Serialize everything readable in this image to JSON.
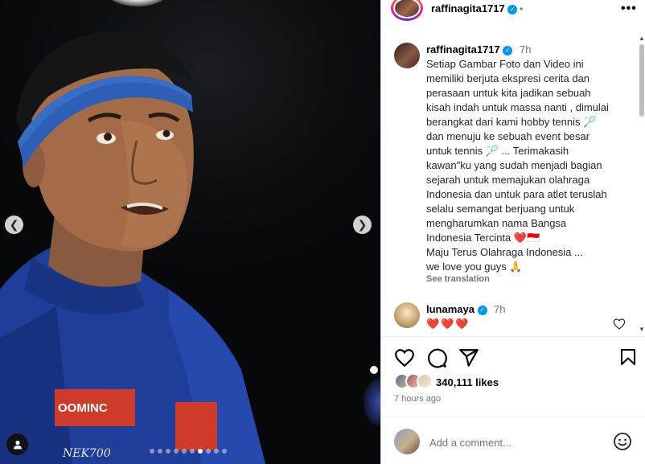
{
  "post": {
    "username": "raffinagita1717",
    "time": "7h",
    "caption": "Setiap Gambar Foto dan Video ini\nmemiliki berjuta ekspresi cerita dan\nperasaan untuk kita jadikan sebuah\nkisah indah untuk massa nanti , dimulai\nberangkat dari kami hobby tennis 🏸\ndan menuju ke sebuah event besar\nuntuk tennis 🏸 ... Terimakasih\nkawan\"ku yang sudah menjadi bagian\nsejarah untuk memajukan olahraga\nIndonesia dan untuk para atlet teruslah\nselalu semangat berjuang untuk\nmengharumkan nama Bangsa\nIndonesia Tercinta ❤️🇮🇩\nMaju Terus Olahraga Indonesia ...\nwe love you guys 🙏",
    "see_translation": "See translation",
    "likes": "340,111 likes",
    "posted_ago": "7 hours ago"
  },
  "comment": {
    "username": "lunamaya",
    "time": "7h",
    "text": "❤️❤️❤️"
  },
  "add_comment": {
    "placeholder": "Add a comment..."
  },
  "carousel": {
    "slide_count": 10,
    "active_index": 6
  },
  "colors": {
    "verified": "#0095f6",
    "media_bg": "#0b0c0f",
    "jersey_blue": "#1f3e9a",
    "headband_blue": "#2d5fb6",
    "muted_text": "#737373"
  },
  "icons": {
    "verified": "verified-badge-icon",
    "more": "more-options-icon",
    "like": "heart-icon",
    "comment": "comment-icon",
    "share": "share-icon",
    "save": "bookmark-icon",
    "emoji": "emoji-icon",
    "user_tag": "user-tag-icon"
  }
}
